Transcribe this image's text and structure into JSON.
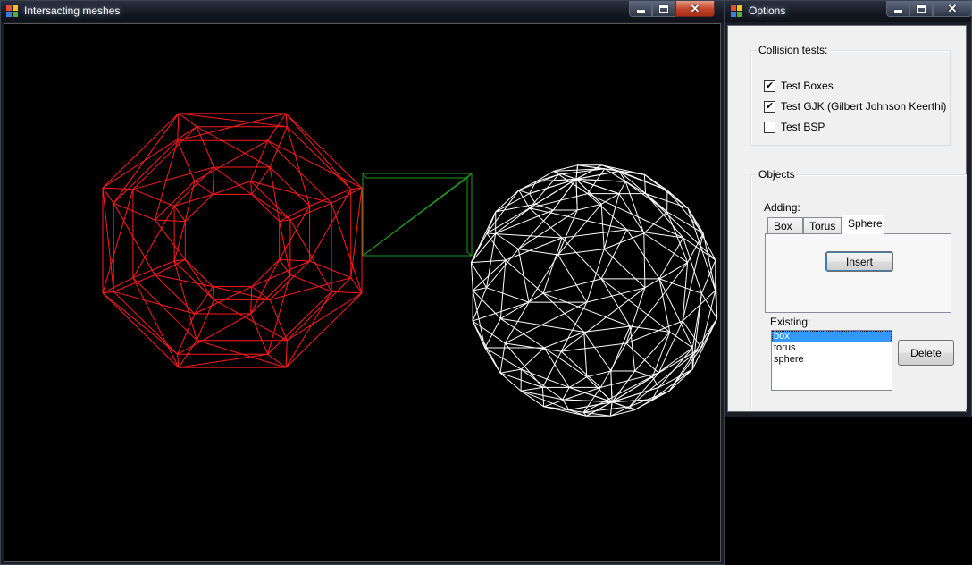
{
  "main_window": {
    "title": "Intersacting meshes",
    "meshes": [
      {
        "name": "torus",
        "color": "#ff1a1a"
      },
      {
        "name": "box",
        "color": "#1f9a1f"
      },
      {
        "name": "sphere",
        "color": "#ffffff"
      }
    ]
  },
  "options_window": {
    "title": "Options",
    "collision_group": {
      "legend": "Collision tests:",
      "checkboxes": [
        {
          "label": "Test Boxes",
          "checked": true
        },
        {
          "label": "Test GJK (Gilbert Johnson Keerthi)",
          "checked": true
        },
        {
          "label": "Test BSP",
          "checked": false
        }
      ]
    },
    "objects_group": {
      "legend": "Objects",
      "adding_label": "Adding:",
      "tabs": [
        {
          "label": "Box",
          "active": false
        },
        {
          "label": "Torus",
          "active": false
        },
        {
          "label": "Sphere",
          "active": true
        }
      ],
      "insert_label": "Insert",
      "existing_label": "Existing:",
      "existing_items": [
        {
          "label": "box",
          "selected": true
        },
        {
          "label": "torus",
          "selected": false
        },
        {
          "label": "sphere",
          "selected": false
        }
      ],
      "delete_label": "Delete"
    }
  },
  "caption_icons": [
    "minimize-icon",
    "maximize-icon",
    "close-icon"
  ]
}
